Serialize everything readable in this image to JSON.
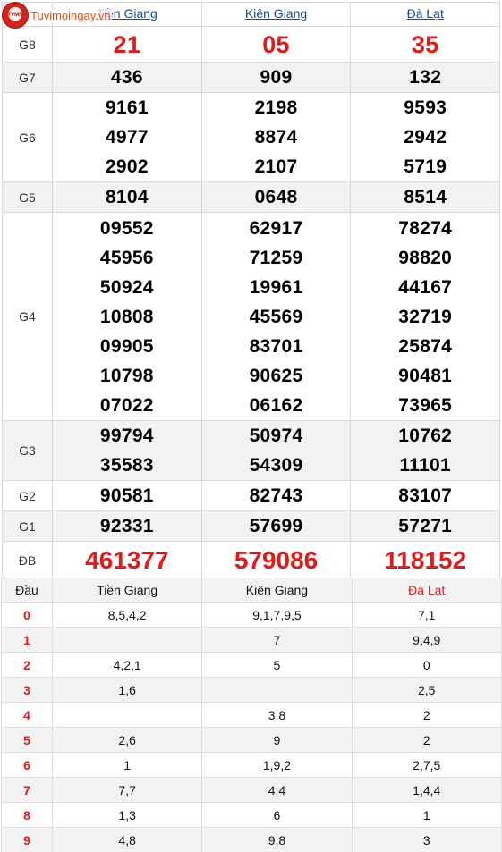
{
  "logo": {
    "badge": "TVMN",
    "text": "Tuvimoingay.vn"
  },
  "results": {
    "provinces": [
      "Tiền Giang",
      "Kiên Giang",
      "Đà Lạt"
    ],
    "prizes": [
      {
        "label": "G8",
        "values": [
          [
            "21"
          ],
          [
            "05"
          ],
          [
            "35"
          ]
        ]
      },
      {
        "label": "G7",
        "values": [
          [
            "436"
          ],
          [
            "909"
          ],
          [
            "132"
          ]
        ]
      },
      {
        "label": "G6",
        "values": [
          [
            "9161",
            "4977",
            "2902"
          ],
          [
            "2198",
            "8874",
            "2107"
          ],
          [
            "9593",
            "2942",
            "5719"
          ]
        ]
      },
      {
        "label": "G5",
        "values": [
          [
            "8104"
          ],
          [
            "0648"
          ],
          [
            "8514"
          ]
        ]
      },
      {
        "label": "G4",
        "values": [
          [
            "09552",
            "45956",
            "50924",
            "10808",
            "09905",
            "10798",
            "07022"
          ],
          [
            "62917",
            "71259",
            "19961",
            "45569",
            "83701",
            "90625",
            "06162"
          ],
          [
            "78274",
            "98820",
            "44167",
            "32719",
            "25874",
            "90481",
            "73965"
          ]
        ]
      },
      {
        "label": "G3",
        "values": [
          [
            "99794",
            "35583"
          ],
          [
            "50974",
            "54309"
          ],
          [
            "10762",
            "11101"
          ]
        ]
      },
      {
        "label": "G2",
        "values": [
          [
            "90581"
          ],
          [
            "82743"
          ],
          [
            "83107"
          ]
        ]
      },
      {
        "label": "G1",
        "values": [
          [
            "92331"
          ],
          [
            "57699"
          ],
          [
            "57271"
          ]
        ]
      },
      {
        "label": "ĐB",
        "values": [
          [
            "461377"
          ],
          [
            "579086"
          ],
          [
            "118152"
          ]
        ]
      }
    ]
  },
  "loto": {
    "headers": [
      "Đầu",
      "Tiền Giang",
      "Kiên Giang",
      "Đà Lạt"
    ],
    "rows": [
      {
        "dau": "0",
        "cells": [
          "8,5,4,2",
          "9,1,7,9,5",
          "7,1"
        ]
      },
      {
        "dau": "1",
        "cells": [
          "",
          "7",
          "9,4,9"
        ]
      },
      {
        "dau": "2",
        "cells": [
          "4,2,1",
          "5",
          "0"
        ]
      },
      {
        "dau": "3",
        "cells": [
          "1,6",
          "",
          "2,5"
        ]
      },
      {
        "dau": "4",
        "cells": [
          "",
          "3,8",
          "2"
        ]
      },
      {
        "dau": "5",
        "cells": [
          "2,6",
          "9",
          "2"
        ]
      },
      {
        "dau": "6",
        "cells": [
          "1",
          "1,9,2",
          "2,7,5"
        ]
      },
      {
        "dau": "7",
        "cells": [
          "7,7",
          "4,4",
          "1,4,4"
        ]
      },
      {
        "dau": "8",
        "cells": [
          "1,3",
          "6",
          "1"
        ]
      },
      {
        "dau": "9",
        "cells": [
          "4,8",
          "9,8",
          "3"
        ]
      }
    ]
  },
  "colors": {
    "accent_red": "#e11b1b",
    "link_blue": "#0c4d9e",
    "stripe": "#f2f2f2"
  }
}
